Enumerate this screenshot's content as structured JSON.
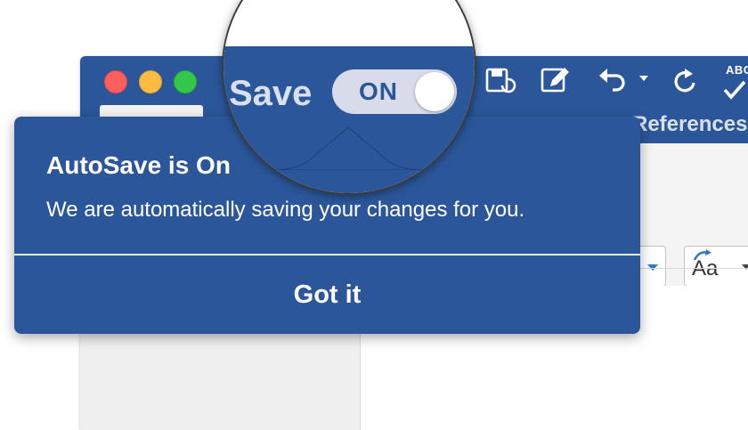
{
  "app": {
    "autosave_label": "Save",
    "autosave_state": "ON",
    "ribbon_tab_references": "References",
    "proofing_abbrev": "ABC",
    "font_color_letter": "A",
    "change_case_label": "Aa"
  },
  "popover": {
    "title": "AutoSave is On",
    "message": "We are automatically saving your changes for you.",
    "button_label": "Got it"
  },
  "colors": {
    "word_blue": "#2b579a",
    "toggle_track": "#d8dcea",
    "highlight_yellow": "#ffff00"
  },
  "icons": {
    "window_controls": [
      "close-icon",
      "minimize-icon",
      "zoom-icon"
    ],
    "toolbar": [
      "save-sync-icon",
      "edit-document-icon",
      "undo-icon",
      "redo-icon",
      "spelling-check-icon"
    ]
  }
}
